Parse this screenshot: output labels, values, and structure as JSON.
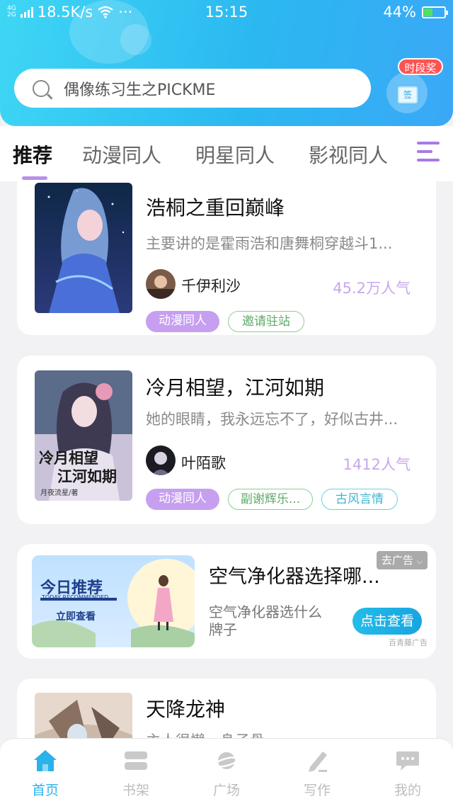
{
  "status_bar": {
    "network_type_top": "4G",
    "network_type_bottom": "2G",
    "speed": "18.5K/s",
    "more": "···",
    "time": "15:15",
    "battery_percent": "44%",
    "battery_level": 0.44
  },
  "header": {
    "search_placeholder": "偶像练习生之PICKME",
    "gift_tag": "时段奖",
    "gift_box_label": "签"
  },
  "tabs": {
    "items": [
      "推荐",
      "动漫同人",
      "明星同人",
      "影视同人"
    ],
    "active_index": 0
  },
  "books": [
    {
      "title": "浩桐之重回巅峰",
      "description": "主要讲的是霍雨浩和唐舞桐穿越斗1...",
      "author": "千伊利沙",
      "popularity": "45.2万人气",
      "tags": [
        "动漫同人",
        "邀请驻站"
      ]
    },
    {
      "title": "冷月相望，江河如期",
      "description": "她的眼睛，我永远忘不了，好似古井...",
      "author": "叶陌歌",
      "popularity": "1412人气",
      "tags": [
        "动漫同人",
        "副谢辉乐...",
        "古风言情"
      ],
      "cover_text_line1": "冷月相望",
      "cover_text_line2": "江河如期",
      "cover_author": "月夜流星/著"
    },
    {
      "title": "天降龙神",
      "description": "主人很懒，身子骨..."
    }
  ],
  "ad": {
    "banner_title": "今日推荐",
    "banner_subtitle": "TODAY RECOMMENDED",
    "banner_button": "立即查看",
    "title": "空气净化器选择哪...",
    "description": "空气净化器选什么牌子",
    "cta": "点击查看",
    "close_label": "去广告",
    "source": "百青藤广告"
  },
  "bottom_nav": {
    "items": [
      {
        "label": "首页",
        "icon": "home-icon"
      },
      {
        "label": "书架",
        "icon": "bookshelf-icon"
      },
      {
        "label": "广场",
        "icon": "planet-icon"
      },
      {
        "label": "写作",
        "icon": "pen-icon"
      },
      {
        "label": "我的",
        "icon": "chat-bubble-icon"
      }
    ],
    "active_index": 0
  },
  "colors": {
    "header_gradient_start": "#3fd6f5",
    "header_gradient_end": "#3aa8f7",
    "accent_purple": "#b690ea",
    "tag_purple": "#c79ff0",
    "popularity": "#c8a7ec",
    "nav_active": "#2ab2ea"
  }
}
